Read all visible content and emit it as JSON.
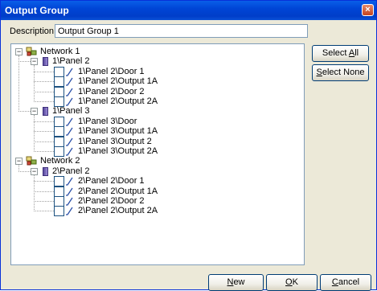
{
  "window": {
    "title": "Output Group",
    "close": "×"
  },
  "description": {
    "label": "Description",
    "value": "Output Group 1"
  },
  "tree": {
    "networks": [
      {
        "label": "Network 1",
        "panels": [
          {
            "label": "1\\Panel 2",
            "outputs": [
              "1\\Panel 2\\Door 1",
              "1\\Panel 2\\Output 1A",
              "1\\Panel 2\\Door 2",
              "1\\Panel 2\\Output 2A"
            ]
          },
          {
            "label": "1\\Panel 3",
            "outputs": [
              "1\\Panel 3\\Door",
              "1\\Panel 3\\Output 1A",
              "1\\Panel 3\\Output 2",
              "1\\Panel 3\\Output 2A"
            ]
          }
        ]
      },
      {
        "label": "Network 2",
        "panels": [
          {
            "label": "2\\Panel 2",
            "outputs": [
              "2\\Panel 2\\Door 1",
              "2\\Panel 2\\Output 1A",
              "2\\Panel 2\\Door 2",
              "2\\Panel 2\\Output 2A"
            ]
          }
        ]
      }
    ]
  },
  "buttons": {
    "select_all": {
      "pre": "Select ",
      "key": "A",
      "post": "ll"
    },
    "select_none": {
      "pre": "",
      "key": "S",
      "post": "elect None"
    },
    "new": {
      "pre": "",
      "key": "N",
      "post": "ew"
    },
    "ok": {
      "pre": "",
      "key": "O",
      "post": "K"
    },
    "cancel": {
      "pre": "",
      "key": "C",
      "post": "ancel"
    }
  }
}
